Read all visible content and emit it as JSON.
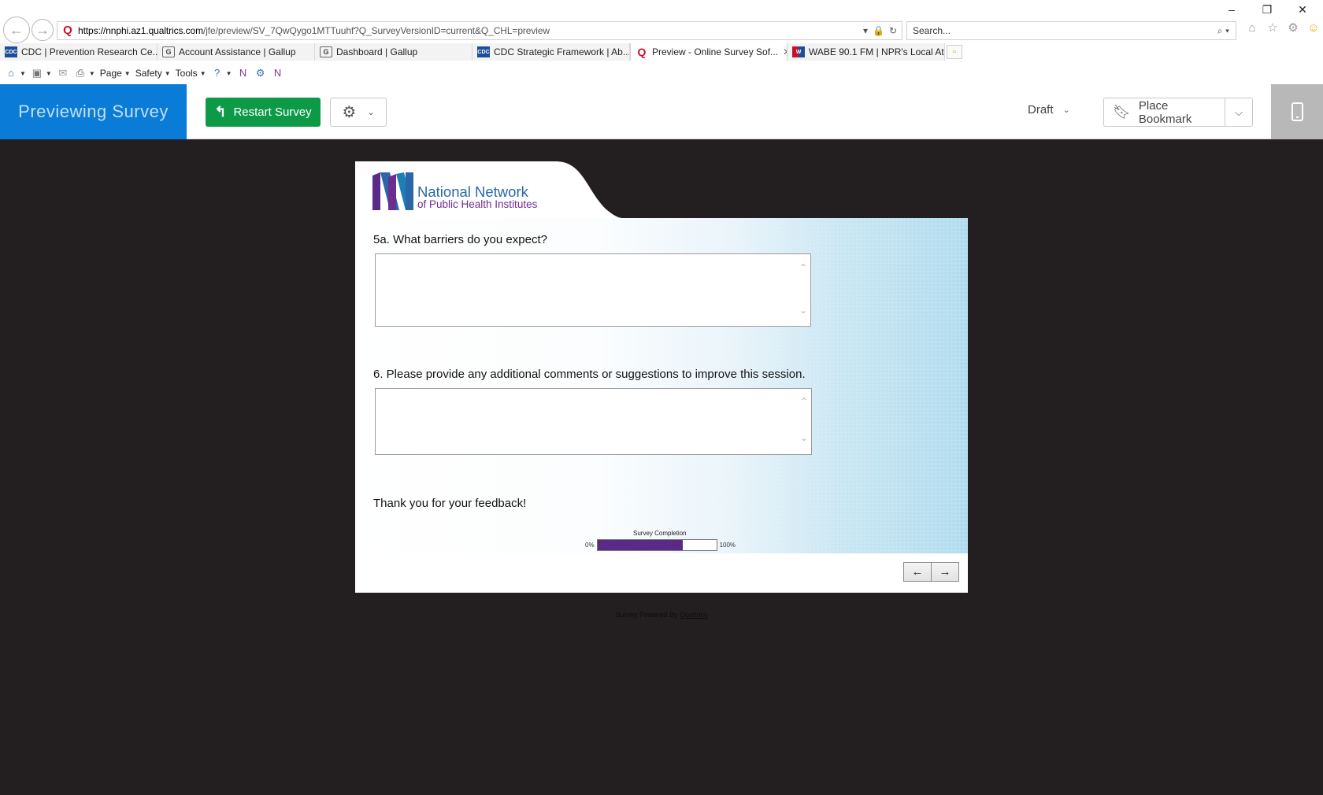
{
  "browser": {
    "url_host": "https://nnphi.az1.qualtrics.com",
    "url_rest": "/jfe/preview/SV_7QwQygo1MTTuuhf?Q_SurveyVersionID=current&Q_CHL=preview",
    "search_placeholder": "Search...",
    "tabs": [
      {
        "label": "CDC | Prevention Research Ce...",
        "favicon": "cdc-favicon"
      },
      {
        "label": "Account Assistance | Gallup",
        "favicon": "gallup-favicon"
      },
      {
        "label": "Dashboard | Gallup",
        "favicon": "gallup-favicon"
      },
      {
        "label": "CDC Strategic Framework | Ab...",
        "favicon": "cdc-favicon"
      },
      {
        "label": "Preview - Online Survey Sof...",
        "favicon": "qualtrics-favicon",
        "active": true
      },
      {
        "label": "WABE 90.1 FM | NPR's Local At...",
        "favicon": "wabe-favicon"
      }
    ],
    "command_bar": {
      "page": "Page",
      "safety": "Safety",
      "tools": "Tools"
    }
  },
  "preview_toolbar": {
    "title": "Previewing Survey",
    "restart": "Restart Survey",
    "version": "Draft",
    "bookmark": "Place Bookmark"
  },
  "survey": {
    "logo": {
      "line1": "National Network",
      "line2": "of Public Health Institutes"
    },
    "questions": [
      {
        "label": "5a. What barriers do you expect?",
        "value": ""
      },
      {
        "label": "6. Please provide any additional comments or suggestions to improve this session.",
        "value": ""
      }
    ],
    "end_message": "Thank you for your feedback!",
    "progress": {
      "label": "Survey Completion",
      "min": "0%",
      "max": "100%",
      "fraction": 0.72
    },
    "prev_label": "←",
    "next_label": "→"
  },
  "footer": {
    "prefix": "Survey Powered By",
    "link": "Qualtrics"
  },
  "colors": {
    "accent_blue": "#0a7bd7",
    "restart_green": "#0d9a47",
    "progress_purple": "#5b2a86"
  }
}
